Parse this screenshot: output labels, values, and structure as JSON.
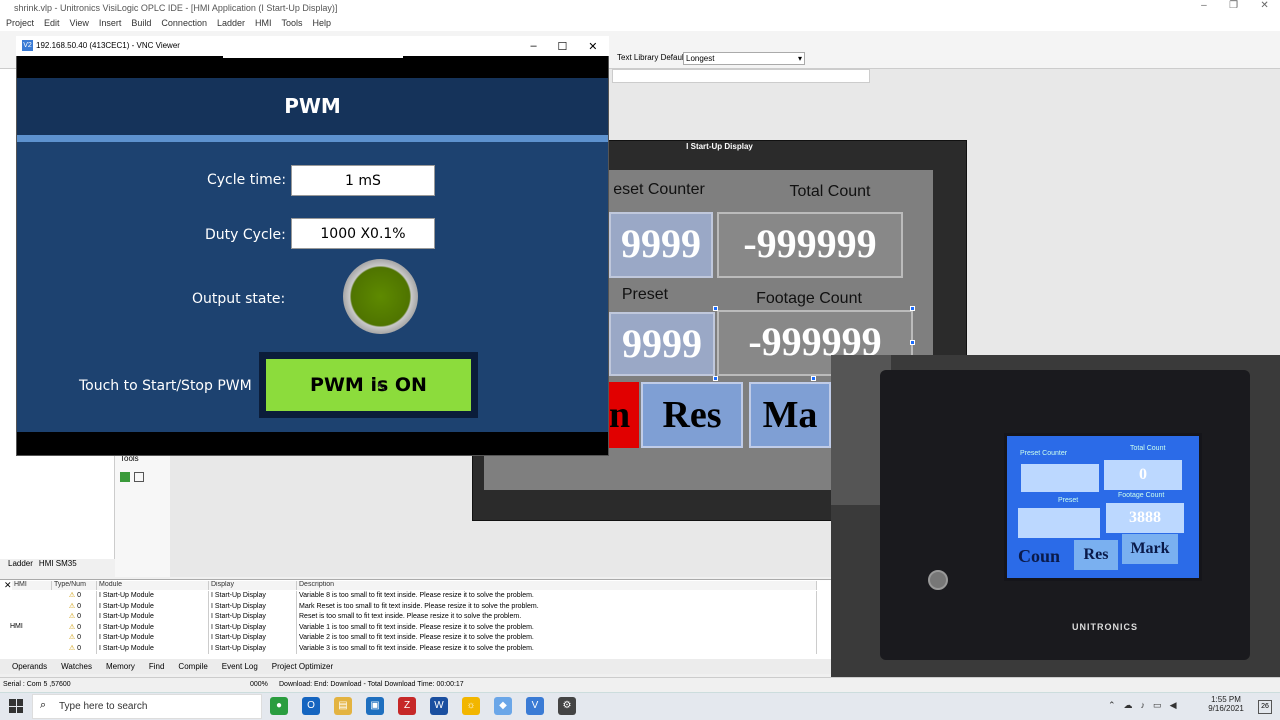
{
  "app": {
    "window_title": "shrink.vlp - Unitronics VisiLogic OPLC IDE - [HMI Application (I Start-Up Display)]"
  },
  "menu": [
    "Project",
    "Edit",
    "View",
    "Insert",
    "Build",
    "Connection",
    "Ladder",
    "HMI",
    "Tools",
    "Help"
  ],
  "toolbar": {
    "text_library_label": "Text Library Default",
    "text_library_value": "Longest"
  },
  "vnc": {
    "title": "192.168.50.40 (413CEC1) - VNC Viewer",
    "icon": "V2",
    "screen_title": "PWM",
    "cycle_time_label": "Cycle time:",
    "cycle_time_value": "1 mS",
    "duty_cycle_label": "Duty Cycle:",
    "duty_cycle_value": "1000 X0.1%",
    "output_state_label": "Output state:",
    "output_state_on": true,
    "touch_label": "Touch to Start/Stop PWM",
    "pwm_button": "PWM is ON",
    "colors": {
      "header": "#15335a",
      "body": "#1d4270",
      "stripe": "#5d92cf",
      "button": "#8cdc3c",
      "lamp": "#5e8a00"
    }
  },
  "hmi": {
    "title": "I Start-Up Display",
    "preset_counter_label": "eset Counter",
    "total_count_label": "Total Count",
    "preset_counter_value": "9999",
    "total_count_value": "-999999",
    "preset_label": "Preset",
    "footage_count_label": "Footage Count",
    "preset_value": "9999",
    "footage_count_value": "-999999",
    "btn_red": "n",
    "btn_reset": "Res",
    "btn_mark": "Ma"
  },
  "photo": {
    "preset_counter": "Preset Counter",
    "total_count": "Total Count",
    "total_value": "0",
    "preset": "Preset",
    "footage_count": "Footage Count",
    "footage_value": "3888",
    "btn_count": "Coun",
    "btn_reset": "Res",
    "btn_mark": "Mark",
    "brand": "UNITRONICS"
  },
  "left": {
    "tools_label": "Tools",
    "tabs": [
      "Ladder",
      "HMI SM35"
    ]
  },
  "errors": {
    "headers": [
      "HMI",
      "Type/Num",
      "Module",
      "Display",
      "Description"
    ],
    "group_label": "HMI",
    "rows": [
      {
        "num": "0",
        "module": "I Start-Up Module",
        "display": "I Start-Up Display",
        "desc": "Variable 8 is too small to fit text inside. Please resize it to solve the problem."
      },
      {
        "num": "0",
        "module": "I Start-Up Module",
        "display": "I Start-Up Display",
        "desc": "Mark Reset is too small to fit text inside. Please resize it to solve the problem."
      },
      {
        "num": "0",
        "module": "I Start-Up Module",
        "display": "I Start-Up Display",
        "desc": "Reset is too small to fit text inside. Please resize it to solve the problem."
      },
      {
        "num": "0",
        "module": "I Start-Up Module",
        "display": "I Start-Up Display",
        "desc": "Variable 1 is too small to fit text inside. Please resize it to solve the problem."
      },
      {
        "num": "0",
        "module": "I Start-Up Module",
        "display": "I Start-Up Display",
        "desc": "Variable 2 is too small to fit text inside. Please resize it to solve the problem."
      },
      {
        "num": "0",
        "module": "I Start-Up Module",
        "display": "I Start-Up Display",
        "desc": "Variable 3 is too small to fit text inside. Please resize it to solve the problem."
      }
    ]
  },
  "bottom_tabs": [
    "Operands",
    "Watches",
    "Memory",
    "Find",
    "Compile",
    "Event Log",
    "Project Optimizer"
  ],
  "status": {
    "serial": "Serial : Com 5 ,57600",
    "zoom": "000%",
    "message": "Download: End: Download - Total Download Time: 00:00:17"
  },
  "taskbar": {
    "search_placeholder": "Type here to search",
    "time": "1:55 PM",
    "date": "9/16/2021",
    "notif": "26"
  }
}
